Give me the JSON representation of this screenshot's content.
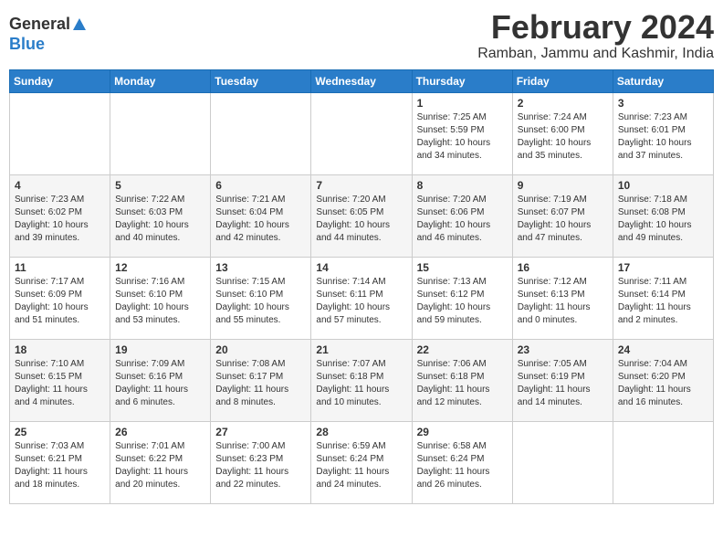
{
  "header": {
    "logo_general": "General",
    "logo_blue": "Blue",
    "month_year": "February 2024",
    "location": "Ramban, Jammu and Kashmir, India"
  },
  "weekdays": [
    "Sunday",
    "Monday",
    "Tuesday",
    "Wednesday",
    "Thursday",
    "Friday",
    "Saturday"
  ],
  "weeks": [
    [
      {
        "day": "",
        "info": ""
      },
      {
        "day": "",
        "info": ""
      },
      {
        "day": "",
        "info": ""
      },
      {
        "day": "",
        "info": ""
      },
      {
        "day": "1",
        "info": "Sunrise: 7:25 AM\nSunset: 5:59 PM\nDaylight: 10 hours\nand 34 minutes."
      },
      {
        "day": "2",
        "info": "Sunrise: 7:24 AM\nSunset: 6:00 PM\nDaylight: 10 hours\nand 35 minutes."
      },
      {
        "day": "3",
        "info": "Sunrise: 7:23 AM\nSunset: 6:01 PM\nDaylight: 10 hours\nand 37 minutes."
      }
    ],
    [
      {
        "day": "4",
        "info": "Sunrise: 7:23 AM\nSunset: 6:02 PM\nDaylight: 10 hours\nand 39 minutes."
      },
      {
        "day": "5",
        "info": "Sunrise: 7:22 AM\nSunset: 6:03 PM\nDaylight: 10 hours\nand 40 minutes."
      },
      {
        "day": "6",
        "info": "Sunrise: 7:21 AM\nSunset: 6:04 PM\nDaylight: 10 hours\nand 42 minutes."
      },
      {
        "day": "7",
        "info": "Sunrise: 7:20 AM\nSunset: 6:05 PM\nDaylight: 10 hours\nand 44 minutes."
      },
      {
        "day": "8",
        "info": "Sunrise: 7:20 AM\nSunset: 6:06 PM\nDaylight: 10 hours\nand 46 minutes."
      },
      {
        "day": "9",
        "info": "Sunrise: 7:19 AM\nSunset: 6:07 PM\nDaylight: 10 hours\nand 47 minutes."
      },
      {
        "day": "10",
        "info": "Sunrise: 7:18 AM\nSunset: 6:08 PM\nDaylight: 10 hours\nand 49 minutes."
      }
    ],
    [
      {
        "day": "11",
        "info": "Sunrise: 7:17 AM\nSunset: 6:09 PM\nDaylight: 10 hours\nand 51 minutes."
      },
      {
        "day": "12",
        "info": "Sunrise: 7:16 AM\nSunset: 6:10 PM\nDaylight: 10 hours\nand 53 minutes."
      },
      {
        "day": "13",
        "info": "Sunrise: 7:15 AM\nSunset: 6:10 PM\nDaylight: 10 hours\nand 55 minutes."
      },
      {
        "day": "14",
        "info": "Sunrise: 7:14 AM\nSunset: 6:11 PM\nDaylight: 10 hours\nand 57 minutes."
      },
      {
        "day": "15",
        "info": "Sunrise: 7:13 AM\nSunset: 6:12 PM\nDaylight: 10 hours\nand 59 minutes."
      },
      {
        "day": "16",
        "info": "Sunrise: 7:12 AM\nSunset: 6:13 PM\nDaylight: 11 hours\nand 0 minutes."
      },
      {
        "day": "17",
        "info": "Sunrise: 7:11 AM\nSunset: 6:14 PM\nDaylight: 11 hours\nand 2 minutes."
      }
    ],
    [
      {
        "day": "18",
        "info": "Sunrise: 7:10 AM\nSunset: 6:15 PM\nDaylight: 11 hours\nand 4 minutes."
      },
      {
        "day": "19",
        "info": "Sunrise: 7:09 AM\nSunset: 6:16 PM\nDaylight: 11 hours\nand 6 minutes."
      },
      {
        "day": "20",
        "info": "Sunrise: 7:08 AM\nSunset: 6:17 PM\nDaylight: 11 hours\nand 8 minutes."
      },
      {
        "day": "21",
        "info": "Sunrise: 7:07 AM\nSunset: 6:18 PM\nDaylight: 11 hours\nand 10 minutes."
      },
      {
        "day": "22",
        "info": "Sunrise: 7:06 AM\nSunset: 6:18 PM\nDaylight: 11 hours\nand 12 minutes."
      },
      {
        "day": "23",
        "info": "Sunrise: 7:05 AM\nSunset: 6:19 PM\nDaylight: 11 hours\nand 14 minutes."
      },
      {
        "day": "24",
        "info": "Sunrise: 7:04 AM\nSunset: 6:20 PM\nDaylight: 11 hours\nand 16 minutes."
      }
    ],
    [
      {
        "day": "25",
        "info": "Sunrise: 7:03 AM\nSunset: 6:21 PM\nDaylight: 11 hours\nand 18 minutes."
      },
      {
        "day": "26",
        "info": "Sunrise: 7:01 AM\nSunset: 6:22 PM\nDaylight: 11 hours\nand 20 minutes."
      },
      {
        "day": "27",
        "info": "Sunrise: 7:00 AM\nSunset: 6:23 PM\nDaylight: 11 hours\nand 22 minutes."
      },
      {
        "day": "28",
        "info": "Sunrise: 6:59 AM\nSunset: 6:24 PM\nDaylight: 11 hours\nand 24 minutes."
      },
      {
        "day": "29",
        "info": "Sunrise: 6:58 AM\nSunset: 6:24 PM\nDaylight: 11 hours\nand 26 minutes."
      },
      {
        "day": "",
        "info": ""
      },
      {
        "day": "",
        "info": ""
      }
    ]
  ]
}
